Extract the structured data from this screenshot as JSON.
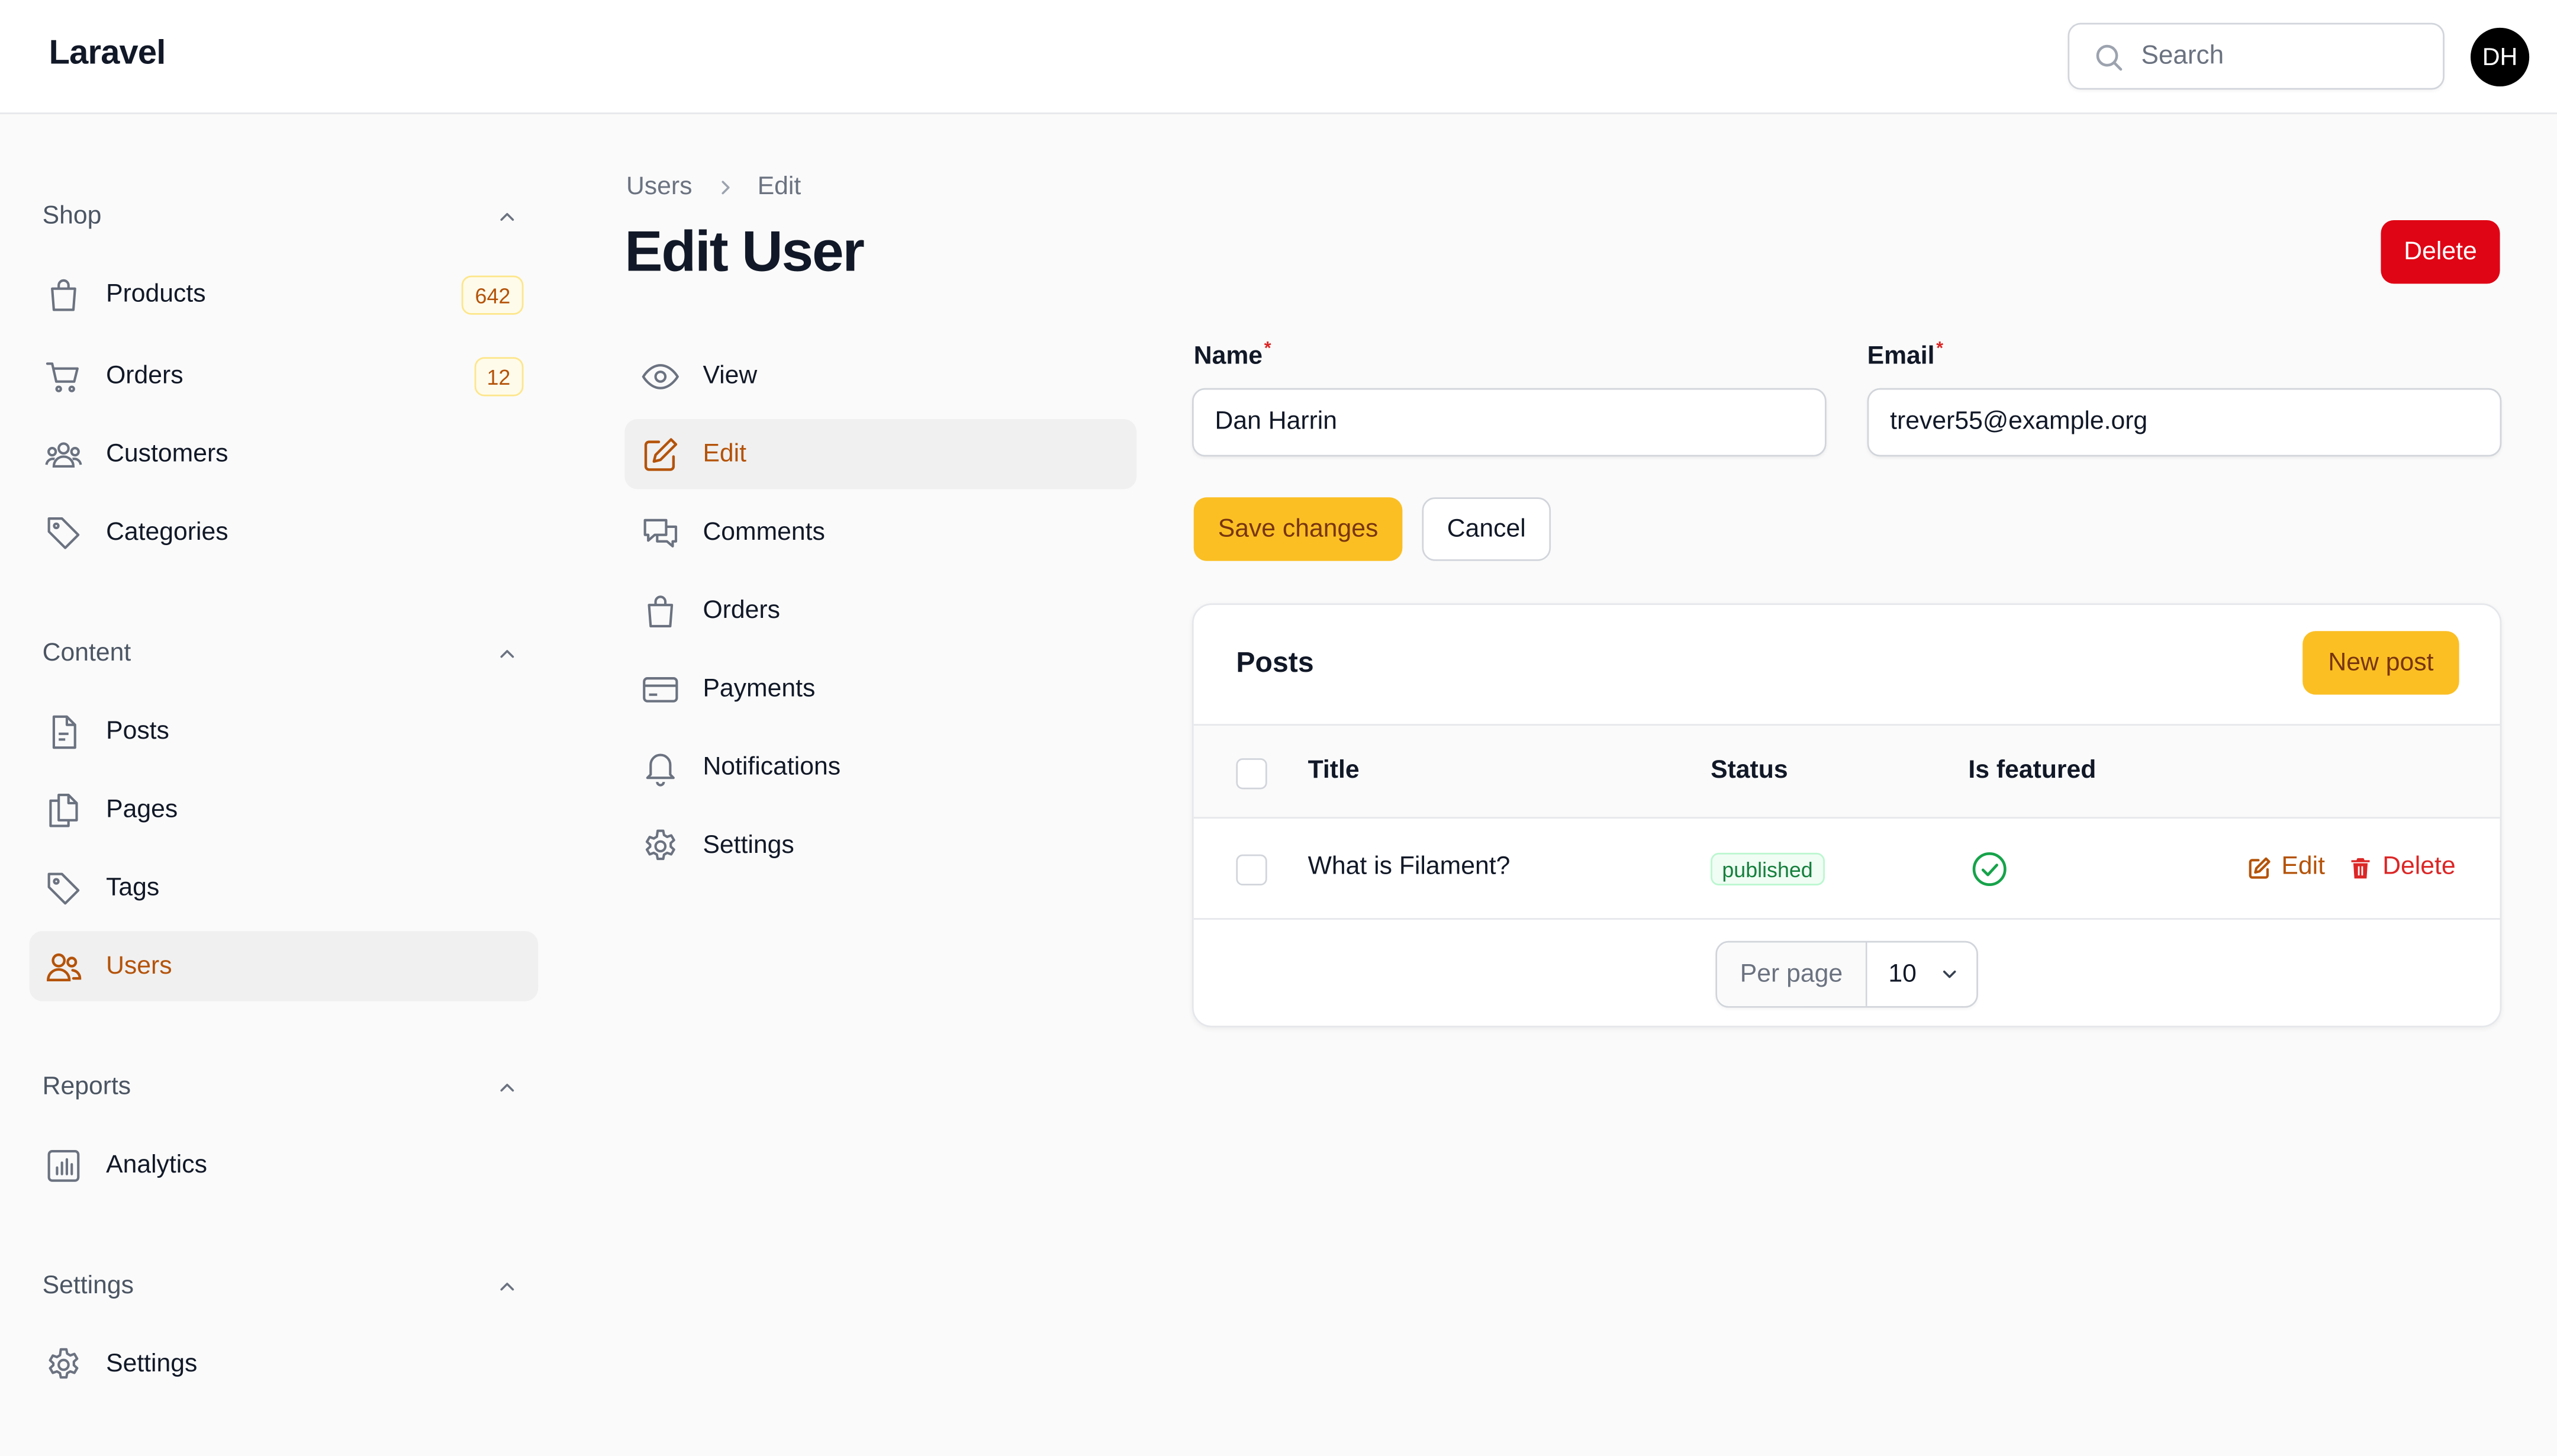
{
  "app": {
    "brand": "Laravel"
  },
  "search": {
    "placeholder": "Search"
  },
  "user": {
    "initials": "DH"
  },
  "sidebar": {
    "groups": [
      {
        "label": "Shop",
        "items": [
          {
            "label": "Products",
            "icon": "shopping-bag-icon",
            "badge": "642"
          },
          {
            "label": "Orders",
            "icon": "shopping-cart-icon",
            "badge": "12"
          },
          {
            "label": "Customers",
            "icon": "users-group-icon"
          },
          {
            "label": "Categories",
            "icon": "tag-icon"
          }
        ]
      },
      {
        "label": "Content",
        "items": [
          {
            "label": "Posts",
            "icon": "document-icon"
          },
          {
            "label": "Pages",
            "icon": "documents-icon"
          },
          {
            "label": "Tags",
            "icon": "tag-icon"
          },
          {
            "label": "Users",
            "icon": "users-icon",
            "active": true
          }
        ]
      },
      {
        "label": "Reports",
        "items": [
          {
            "label": "Analytics",
            "icon": "chart-bar-icon"
          }
        ]
      },
      {
        "label": "Settings",
        "items": [
          {
            "label": "Settings",
            "icon": "cog-icon"
          }
        ]
      }
    ]
  },
  "breadcrumb": {
    "parent": "Users",
    "current": "Edit"
  },
  "page": {
    "title": "Edit User",
    "delete_label": "Delete"
  },
  "subnav": [
    {
      "label": "View",
      "icon": "eye-icon"
    },
    {
      "label": "Edit",
      "icon": "pencil-square-icon",
      "active": true
    },
    {
      "label": "Comments",
      "icon": "chat-bubbles-icon"
    },
    {
      "label": "Orders",
      "icon": "shopping-bag-icon"
    },
    {
      "label": "Payments",
      "icon": "credit-card-icon"
    },
    {
      "label": "Notifications",
      "icon": "bell-icon"
    },
    {
      "label": "Settings",
      "icon": "cog-icon"
    }
  ],
  "form": {
    "name": {
      "label": "Name",
      "required_mark": "*",
      "value": "Dan Harrin"
    },
    "email": {
      "label": "Email",
      "required_mark": "*",
      "value": "trever55@example.org"
    },
    "save_label": "Save changes",
    "cancel_label": "Cancel"
  },
  "posts": {
    "title": "Posts",
    "new_label": "New post",
    "columns": [
      "Title",
      "Status",
      "Is featured"
    ],
    "rows": [
      {
        "title": "What is Filament?",
        "status": "published",
        "featured": true,
        "edit_label": "Edit",
        "delete_label": "Delete"
      }
    ],
    "pagination": {
      "per_page_label": "Per page",
      "per_page_value": "10"
    }
  },
  "colors": {
    "accent": "#b45309",
    "primary": "#fbbf24",
    "danger": "#e00514",
    "success": "#16a34a"
  }
}
